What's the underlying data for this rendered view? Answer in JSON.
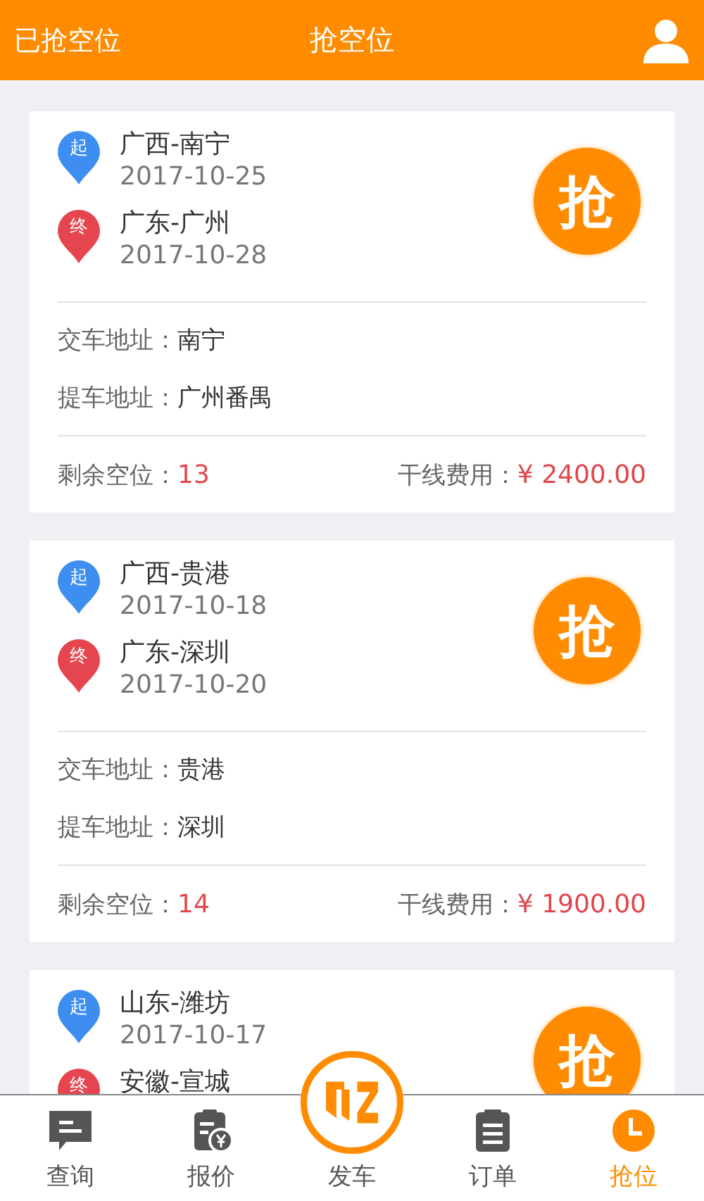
{
  "header": {
    "left_link": "已抢空位",
    "title": "抢空位"
  },
  "cards": [
    {
      "start": {
        "badge": "起",
        "place": "广西-南宁",
        "date": "2017-10-25"
      },
      "end": {
        "badge": "终",
        "place": "广东-广州",
        "date": "2017-10-28"
      },
      "grab": "抢",
      "details": [
        {
          "label": "交车地址：",
          "value": "南宁"
        },
        {
          "label": "提车地址：",
          "value": "广州番禺"
        }
      ],
      "seats": {
        "label": "剩余空位：",
        "value": "13"
      },
      "fee": {
        "label": "干线费用：",
        "value": "¥ 2400.00"
      }
    },
    {
      "start": {
        "badge": "起",
        "place": "广西-贵港",
        "date": "2017-10-18"
      },
      "end": {
        "badge": "终",
        "place": "广东-深圳",
        "date": "2017-10-20"
      },
      "grab": "抢",
      "details": [
        {
          "label": "交车地址：",
          "value": "贵港"
        },
        {
          "label": "提车地址：",
          "value": "深圳"
        }
      ],
      "seats": {
        "label": "剩余空位：",
        "value": "14"
      },
      "fee": {
        "label": "干线费用：",
        "value": "¥ 1900.00"
      }
    },
    {
      "start": {
        "badge": "起",
        "place": "山东-潍坊",
        "date": "2017-10-17"
      },
      "end": {
        "badge": "终",
        "place": "安徽-宣城"
      },
      "grab": "抢"
    }
  ],
  "tabs": [
    {
      "label": "查询",
      "kind": "chat",
      "selected": false
    },
    {
      "label": "报价",
      "kind": "quote",
      "selected": false
    },
    {
      "label": "发车",
      "kind": "launch",
      "selected": false
    },
    {
      "label": "订单",
      "kind": "order",
      "selected": false
    },
    {
      "label": "抢位",
      "kind": "clock",
      "selected": true
    }
  ]
}
